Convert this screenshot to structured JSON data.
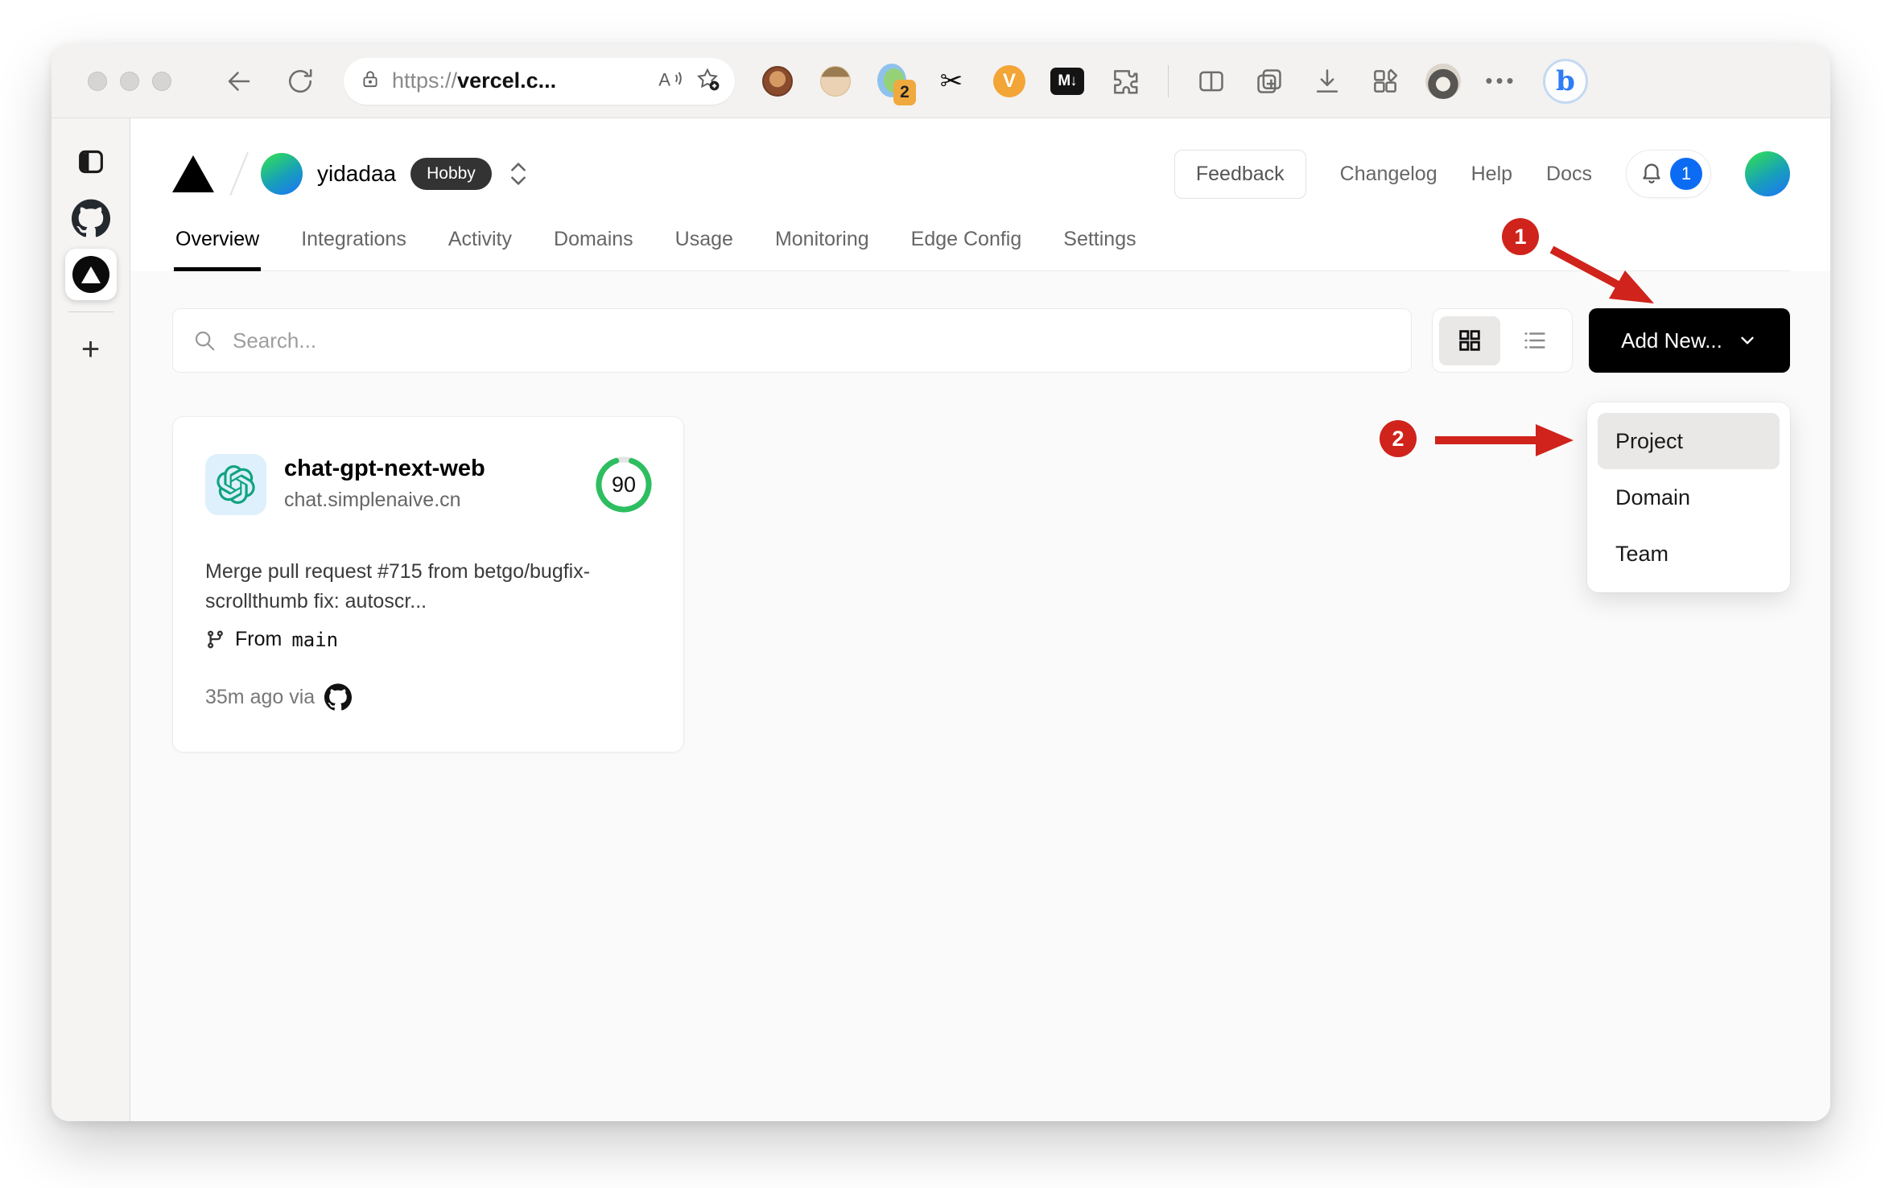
{
  "browser": {
    "url_protocol": "https://",
    "url_host": "vercel.c...",
    "extension_badge": "2",
    "vc_label": "V",
    "md_label": "M↓",
    "more_dots": "•••",
    "bing_label": "b"
  },
  "sidebar": {
    "new_tab_label": "+"
  },
  "header": {
    "team_name": "yidadaa",
    "plan_badge": "Hobby",
    "feedback_label": "Feedback",
    "links": [
      {
        "label": "Changelog"
      },
      {
        "label": "Help"
      },
      {
        "label": "Docs"
      }
    ],
    "notification_count": "1"
  },
  "tabs": [
    {
      "label": "Overview",
      "active": true
    },
    {
      "label": "Integrations",
      "active": false
    },
    {
      "label": "Activity",
      "active": false
    },
    {
      "label": "Domains",
      "active": false
    },
    {
      "label": "Usage",
      "active": false
    },
    {
      "label": "Monitoring",
      "active": false
    },
    {
      "label": "Edge Config",
      "active": false
    },
    {
      "label": "Settings",
      "active": false
    }
  ],
  "controls": {
    "search_placeholder": "Search...",
    "add_new_label": "Add New..."
  },
  "menu": {
    "highlighted": "Project",
    "items": [
      {
        "label": "Project"
      },
      {
        "label": "Domain"
      },
      {
        "label": "Team"
      }
    ]
  },
  "project_card": {
    "name": "chat-gpt-next-web",
    "domain": "chat.simplenaive.cn",
    "score": "90",
    "commit_message": "Merge pull request #715 from betgo/bugfix-scrollthumb fix: autoscr...",
    "from_label": "From",
    "branch": "main",
    "deployed_meta": "35m ago via"
  },
  "annotations": {
    "step1": "1",
    "step2": "2"
  },
  "colors": {
    "annotation_red": "#cf231c",
    "add_new_bg": "#000000",
    "notification_blue": "#0b6cf3",
    "score_green": "#2dbe60",
    "openai_teal": "#10a37f",
    "plan_badge_bg": "#333333"
  }
}
